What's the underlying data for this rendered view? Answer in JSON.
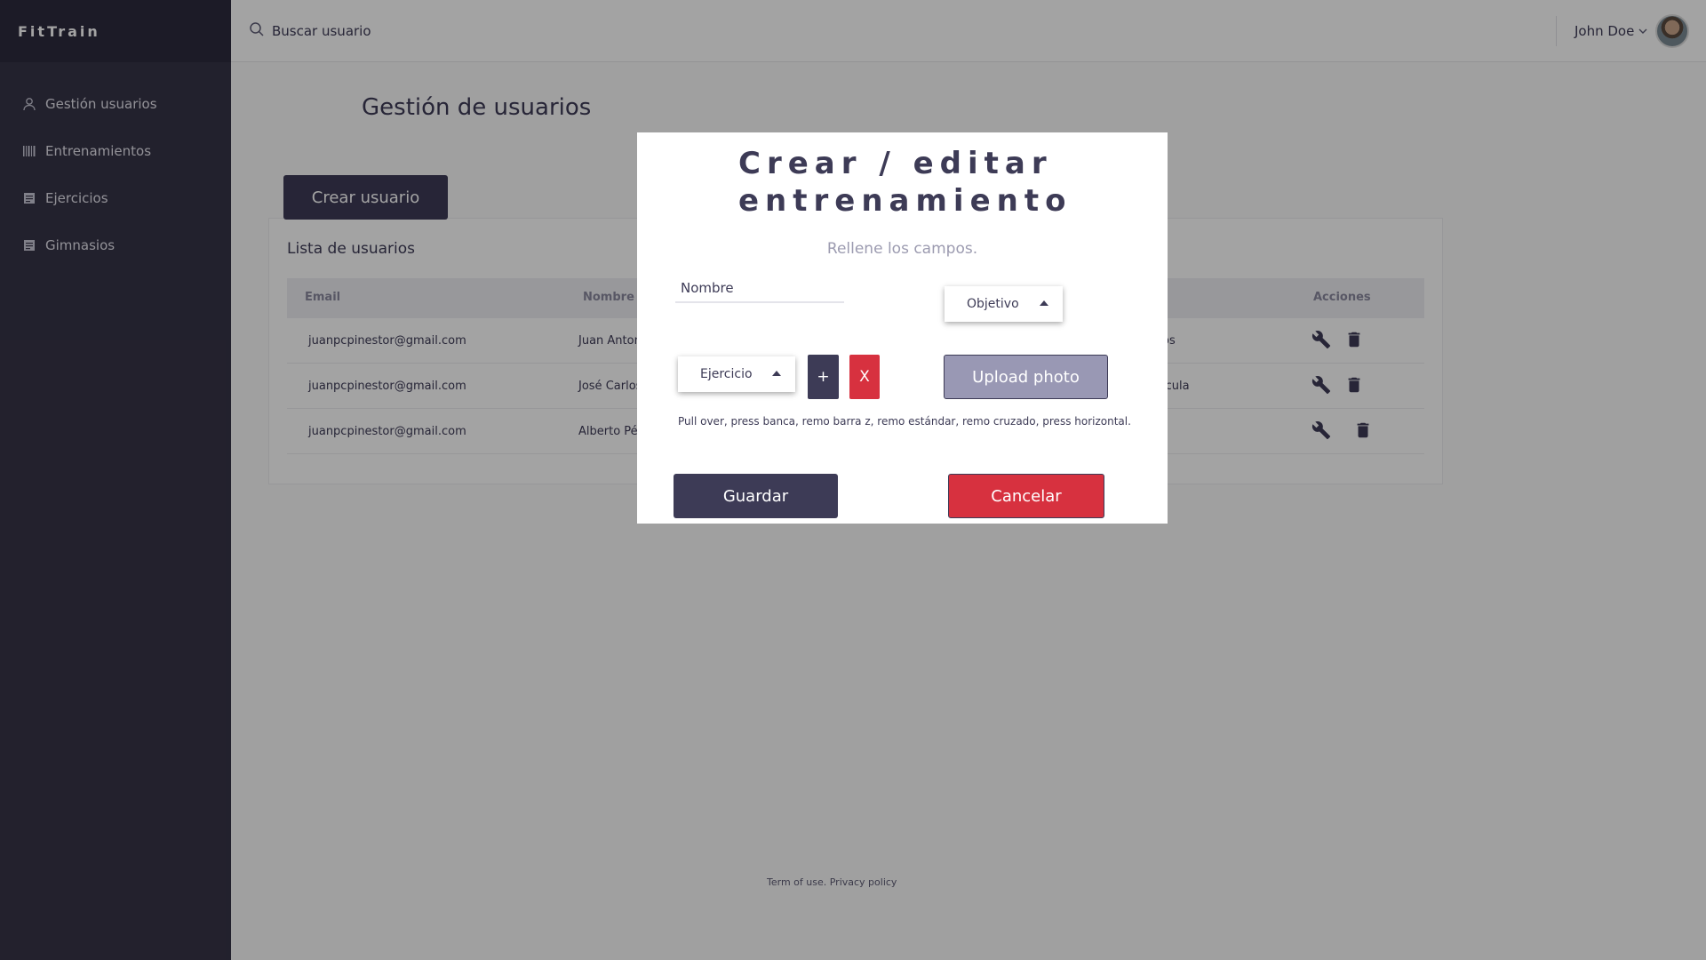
{
  "app": {
    "brand": "FitTrain"
  },
  "sidebar": {
    "items": [
      {
        "label": "Gestión usuarios",
        "icon": "user-icon"
      },
      {
        "label": "Entrenamientos",
        "icon": "barcode-icon"
      },
      {
        "label": "Ejercicios",
        "icon": "document-icon"
      },
      {
        "label": "Gimnasios",
        "icon": "document-icon"
      }
    ]
  },
  "topbar": {
    "search_placeholder": "Buscar usuario",
    "user_name": "John Doe"
  },
  "main": {
    "title": "Gestión de usuarios",
    "create_button": "Crear usuario",
    "list_title": "Lista de usuarios",
    "columns": {
      "email": "Email",
      "name": "Nombre",
      "actions": "Acciones"
    },
    "rows": [
      {
        "email": "juanpcpinestor@gmail.com",
        "name": "Juan Anton",
        "extra": "os"
      },
      {
        "email": "juanpcpinestor@gmail.com",
        "name": "José Carlos",
        "extra": "ícula"
      },
      {
        "email": "juanpcpinestor@gmail.com",
        "name": "Alberto Pér",
        "extra": ""
      }
    ]
  },
  "footer": {
    "terms": "Term of use.",
    "privacy": "Privacy policy"
  },
  "modal": {
    "title": "Crear / editar entrenamiento",
    "subtitle": "Rellene los campos.",
    "name_placeholder": "Nombre",
    "objective_dropdown": "Objetivo",
    "exercise_dropdown": "Ejercicio",
    "add_label": "+",
    "remove_label": "X",
    "upload_label": "Upload photo",
    "exercises_text": "Pull over, press banca, remo barra z, remo estándar, remo cruzado, press horizontal.",
    "save_label": "Guardar",
    "cancel_label": "Cancelar"
  },
  "colors": {
    "sidebar": "#363447",
    "primary": "#3d3b56",
    "danger": "#d7313f",
    "upload": "#9998b4"
  }
}
